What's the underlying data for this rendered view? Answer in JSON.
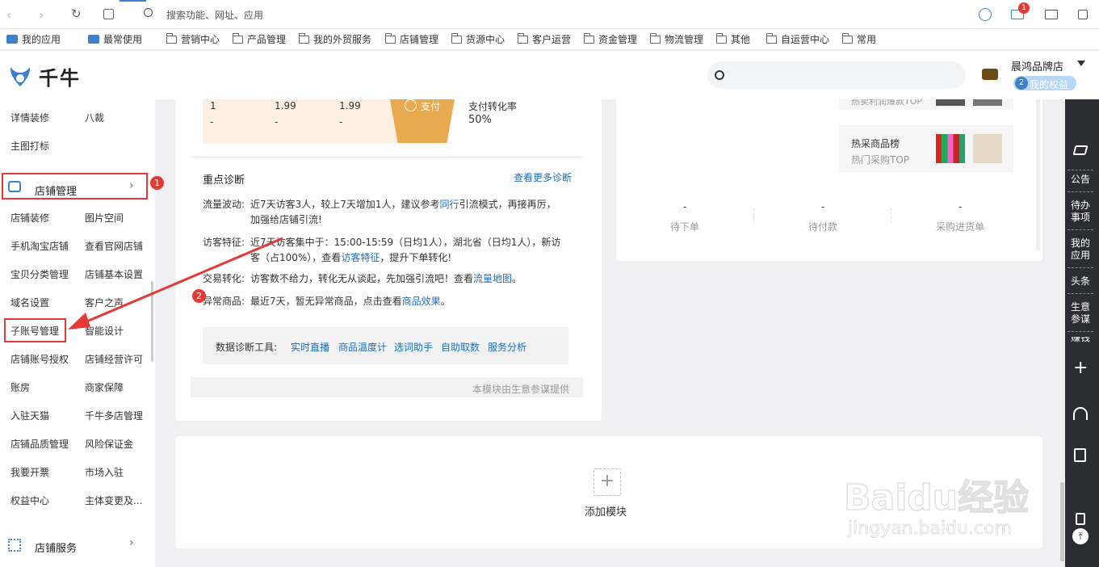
{
  "browser": {
    "search_placeholder": "搜索功能、网址、应用",
    "mail_badge": "1"
  },
  "bookmarks": [
    "我的应用",
    "最常使用",
    "营销中心",
    "产品管理",
    "我的外贸服务",
    "店铺管理",
    "货源中心",
    "客户运营",
    "资金管理",
    "物流管理",
    "其他",
    "自运营中心",
    "常用"
  ],
  "header": {
    "logo_text": "千牛",
    "shop_name": "晨鸿品牌店",
    "rights_badge": "2",
    "rights_label": "我的权益"
  },
  "sidebar": {
    "top_rows": [
      [
        "详情装修",
        "八裁"
      ],
      [
        "主图打标",
        ""
      ]
    ],
    "section_title": "店铺管理",
    "items": [
      [
        "店铺装修",
        "图片空间"
      ],
      [
        "手机淘宝店铺",
        "查看官网店铺"
      ],
      [
        "宝贝分类管理",
        "店铺基本设置"
      ],
      [
        "域名设置",
        "客户之声"
      ],
      [
        "子账号管理",
        "智能设计"
      ],
      [
        "店铺账号授权",
        "店铺经营许可"
      ],
      [
        "账房",
        "商家保障"
      ],
      [
        "入驻天猫",
        "千牛多店管理"
      ],
      [
        "店铺品质管理",
        "风险保证金"
      ],
      [
        "我要开票",
        "市场入驻"
      ],
      [
        "权益中心",
        "主体变更及..."
      ]
    ],
    "bottom_title": "店铺服务"
  },
  "funnel": {
    "row1": [
      "1",
      "1.99",
      "1.99"
    ],
    "row2": [
      "-",
      "-",
      "-"
    ],
    "pay_label": "支付",
    "rate_label": "支付转化率",
    "rate_value": "50%"
  },
  "diagnosis": {
    "title": "重点诊断",
    "more_link": "查看更多诊断",
    "traffic_label": "流量波动:",
    "traffic_text1": "近7天访客3人，较上7天增加1人，建议参考",
    "traffic_link": "同行",
    "traffic_text2": "引流模式，再接再厉，",
    "traffic_text3": "加强给店铺引流!",
    "visitor_label": "访客特征:",
    "visitor_text1": "近7天访客集中于：15:00-15:59（日均1人），湖北省（日均1人），新访",
    "visitor_text2": "客（占100%），查看",
    "visitor_link": "访客特征",
    "visitor_text3": "，提升下单转化!",
    "trade_label": "交易转化:",
    "trade_text": "访客数不给力，转化无从谈起，先加强引流吧！查看",
    "trade_link": "流量地图",
    "trade_end": "。",
    "abnormal_label": "异常商品:",
    "abnormal_text": "最近7天，暂无异常商品，点击查看",
    "abnormal_link": "商品效果",
    "abnormal_end": "。",
    "tools_label": "数据诊断工具:",
    "tools": [
      "实时直播",
      "商品温度计",
      "选词助手",
      "自助取数",
      "服务分析"
    ],
    "footer": "本模块由生意参谋提供"
  },
  "right_panel": {
    "top_cut": "热卖利润爆款TOP",
    "hot_title": "热采商品榜",
    "hot_sub": "热门采购TOP",
    "stats": [
      [
        "-",
        "待下单"
      ],
      [
        "-",
        "待付款"
      ],
      [
        "-",
        "采购进货单"
      ]
    ]
  },
  "add_module": {
    "label": "添加模块"
  },
  "rightbar": {
    "items": [
      "公告",
      "待办事项",
      "我的应用",
      "头条",
      "生意参谋",
      "赚钱"
    ]
  },
  "annotations": {
    "one": "1",
    "two": "2"
  },
  "watermark": {
    "main": "Baidu经验",
    "sub": "jingyan.baidu.com"
  },
  "colors": {
    "accent": "#1a6fc2",
    "annotation": "#e53935",
    "pay": "#e9a94e"
  }
}
